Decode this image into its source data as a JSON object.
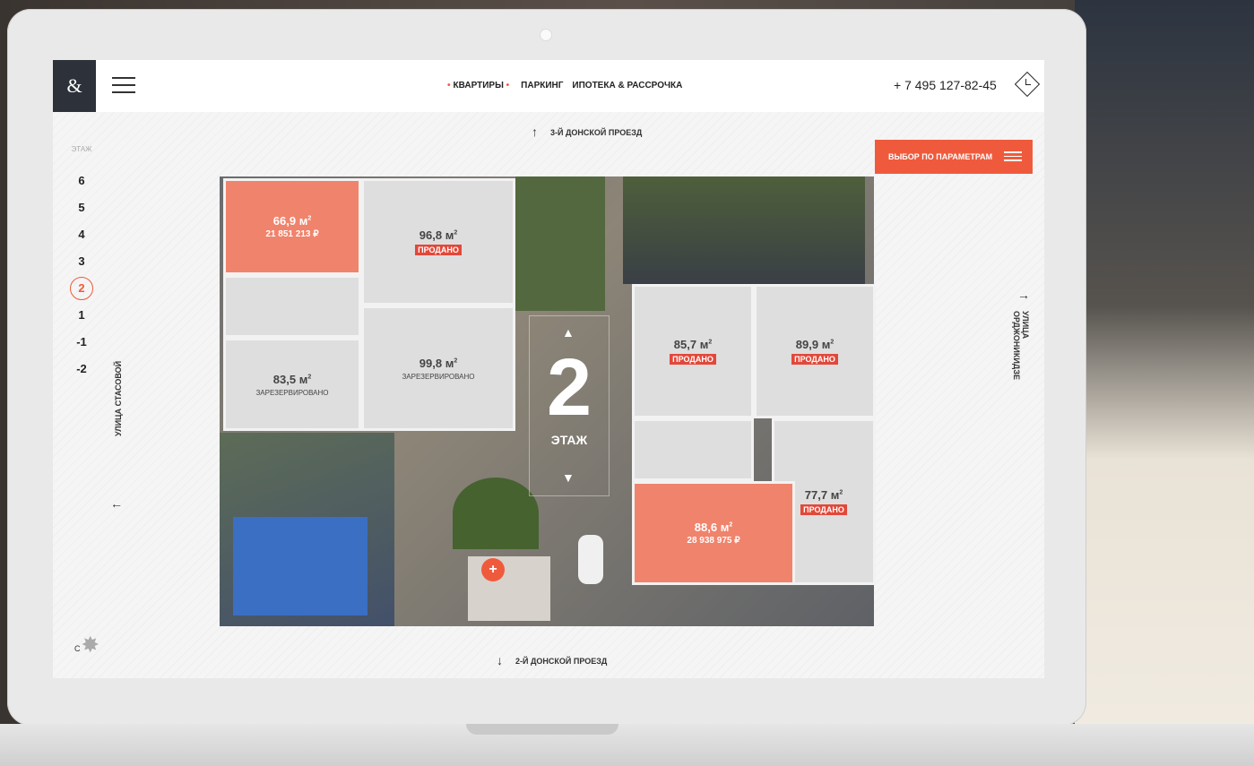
{
  "header": {
    "logo": "&",
    "nav": [
      "КВАРТИРЫ",
      "ПАРКИНГ",
      "ИПОТЕКА & РАССРОЧКА"
    ],
    "phone": "+ 7 495 127-82-45"
  },
  "floors": {
    "label": "ЭТАЖ",
    "items": [
      "6",
      "5",
      "4",
      "3",
      "2",
      "1",
      "-1",
      "-2"
    ],
    "active": "2"
  },
  "streets": {
    "top": "3-Й ДОНСКОЙ ПРОЕЗД",
    "bottom": "2-Й ДОНСКОЙ ПРОЕЗД",
    "left": "УЛИЦА СТАСОВОЙ",
    "right": "УЛИЦА ОРДЖОНИКИДЗЕ"
  },
  "params_button": "ВЫБОР ПО ПАРАМЕТРАМ",
  "floor_badge": {
    "number": "2",
    "word": "ЭТАЖ"
  },
  "apartments": [
    {
      "area": "66,9 м",
      "price": "21 851 213 ₽",
      "status": "available"
    },
    {
      "area": "96,8 м",
      "status_label": "ПРОДАНО"
    },
    {
      "area": "99,8 м",
      "status_label": "ЗАРЕЗЕРВИРОВАНО"
    },
    {
      "area": "83,5 м",
      "status_label": "ЗАРЕЗЕРВИРОВАНО"
    },
    {
      "area": "85,7 м",
      "status_label": "ПРОДАНО"
    },
    {
      "area": "89,9 м",
      "status_label": "ПРОДАНО"
    },
    {
      "area": "77,7 м",
      "status_label": "ПРОДАНО"
    },
    {
      "area": "88,6 м",
      "price": "28 938 975 ₽",
      "status": "available"
    }
  ],
  "compass": "С",
  "colors": {
    "accent": "#f05a3c",
    "dark": "#2d3139"
  }
}
